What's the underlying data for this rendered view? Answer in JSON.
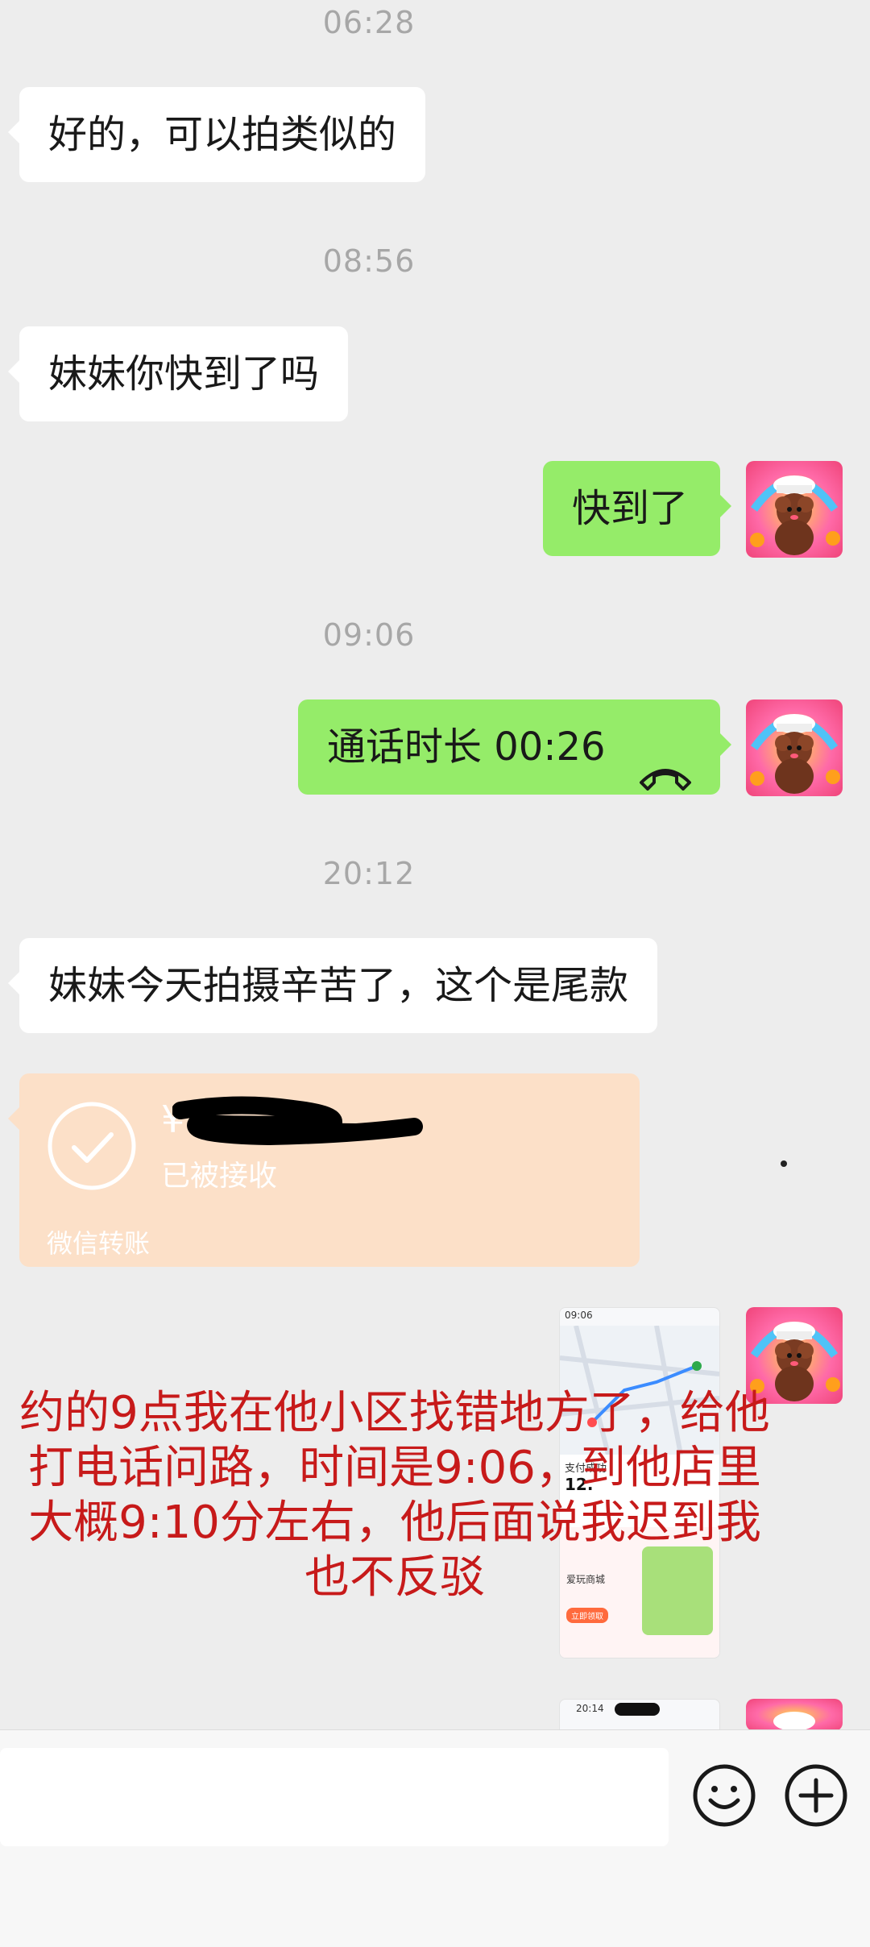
{
  "timestamps": [
    "06:28",
    "08:56",
    "09:06",
    "20:12"
  ],
  "messages": {
    "m1": "好的，可以拍类似的",
    "m2": "妹妹你快到了吗",
    "m3": "快到了",
    "m4": "通话时长 00:26",
    "m5": "妹妹今天拍摄辛苦了，这个是尾款"
  },
  "transfer": {
    "currency_symbol": "¥",
    "status": "已被接收",
    "label": "微信转账"
  },
  "overlay_lines": [
    "约的9点我在他小区找错地方了，给他",
    "打电话问路，时间是9:06，到他店里",
    "大概9:10分左右，他后面说我迟到我",
    "也不反驳"
  ],
  "thumb1": {
    "time": "09:06",
    "title": "支付成功",
    "amount": "12.",
    "item": "爱玩商城",
    "btn": "立即领取"
  },
  "thumb2": {
    "time": "20:14"
  },
  "colors": {
    "background": "#ededed",
    "incoming_bubble": "#ffffff",
    "outgoing_bubble": "#95ec69",
    "transfer_card": "#fce0c8",
    "overlay_text": "#c71a1a"
  },
  "icons": {
    "call": "phone-hangup-icon",
    "emoji": "emoji-icon",
    "plus": "plus-icon",
    "check": "check-circle-icon"
  }
}
